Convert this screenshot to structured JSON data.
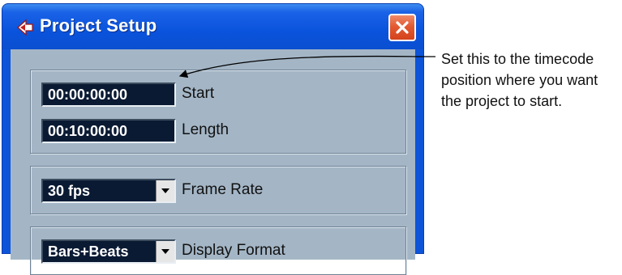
{
  "window": {
    "title": "Project Setup",
    "close_label": "×"
  },
  "timecode": {
    "start_value": "00:00:00:00",
    "start_label": "Start",
    "length_value": "00:10:00:00",
    "length_label": "Length"
  },
  "frame_rate": {
    "value": "30 fps",
    "label": "Frame Rate"
  },
  "display_format": {
    "value": "Bars+Beats",
    "label": "Display Format"
  },
  "annotation": {
    "line1": "Set this to the timecode",
    "line2": "position where you want",
    "line3": "the project to start."
  },
  "colors": {
    "titlebar": "#0a53dc",
    "client": "#a4b6c6",
    "field": "#0a1a33",
    "close": "#e25a32"
  }
}
